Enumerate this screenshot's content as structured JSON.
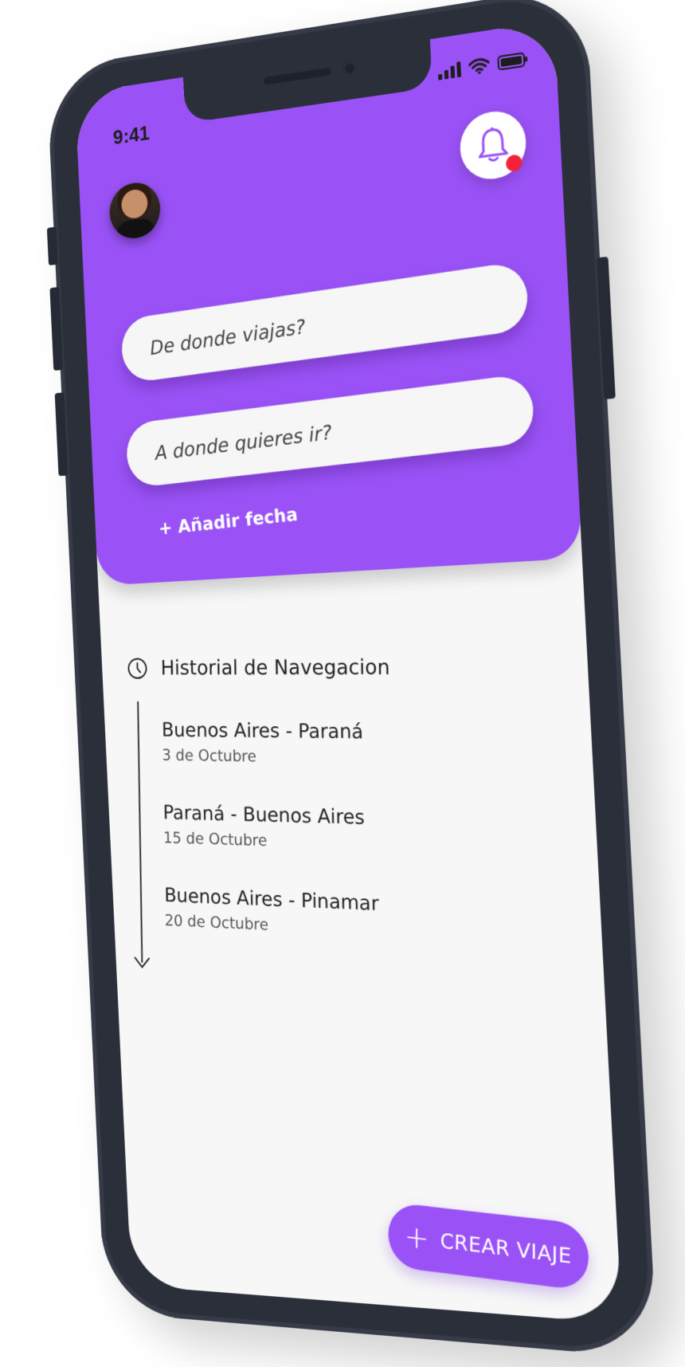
{
  "status_bar": {
    "time": "9:41"
  },
  "header": {
    "avatar_label": "user-avatar",
    "notification_icon": "bell-icon",
    "notification_dot_color": "#f4213a",
    "accent_color": "#9a52f6"
  },
  "search": {
    "from_placeholder": "De donde viajas?",
    "to_placeholder": "A donde quieres ir?",
    "add_date_label": "+ Añadir fecha"
  },
  "history": {
    "title": "Historial de Navegacion",
    "icon": "clock-icon",
    "trips": [
      {
        "route": "Buenos Aires - Paraná",
        "date": "3 de Octubre"
      },
      {
        "route": "Paraná - Buenos Aires",
        "date": "15 de Octubre"
      },
      {
        "route": "Buenos Aires - Pinamar",
        "date": "20 de Octubre"
      }
    ]
  },
  "actions": {
    "create_trip_icon": "+",
    "create_trip_label": "CREAR VIAJE"
  }
}
